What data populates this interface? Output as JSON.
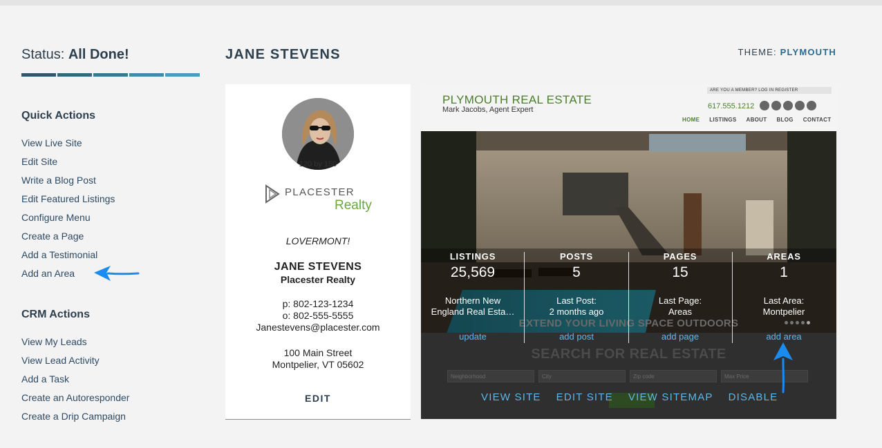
{
  "status": {
    "label": "Status:",
    "value": "All Done!",
    "bar_colors": [
      "#2e5871",
      "#33667f",
      "#3a7793",
      "#4389a8",
      "#4b9bbd"
    ]
  },
  "quick_actions": {
    "heading": "Quick Actions",
    "items": [
      "View Live Site",
      "Edit Site",
      "Write a Blog Post",
      "Edit Featured Listings",
      "Configure Menu",
      "Create a Page",
      "Add a Testimonial",
      "Add an Area"
    ]
  },
  "crm_actions": {
    "heading": "CRM Actions",
    "items": [
      "View My Leads",
      "View Lead Activity",
      "Add a Task",
      "Create an Autoresponder",
      "Create a Drip Campaign"
    ]
  },
  "header": {
    "site_name": "JANE STEVENS",
    "theme_label": "THEME:",
    "theme_name": "PLYMOUTH"
  },
  "profile": {
    "avatar_caption": "120 by 150",
    "logo_word1": "PLACESTER",
    "logo_word2": "Realty",
    "tagline": "LOVERMONT!",
    "name": "JANE STEVENS",
    "company": "Placester Realty",
    "phone": "p: 802-123-1234",
    "office": "o: 802-555-5555",
    "email": "Janestevens@placester.com",
    "address1": "100 Main Street",
    "address2": "Montpelier, VT 05602",
    "edit_label": "EDIT"
  },
  "preview": {
    "title": "PLYMOUTH REAL ESTATE",
    "subtitle": "Mark Jacobs, Agent Expert",
    "member_bar": "ARE YOU A MEMBER?   LOG IN   REGISTER",
    "phone": "617.555.1212",
    "nav": [
      "HOME",
      "LISTINGS",
      "ABOUT",
      "BLOG",
      "CONTACT"
    ],
    "extend_text": "EXTEND YOUR LIVING SPACE OUTDOORS",
    "search_text": "SEARCH FOR REAL ESTATE",
    "fields": [
      "Neighborhood",
      "City",
      "Zip code",
      "Max Price"
    ]
  },
  "stats": [
    {
      "label": "LISTINGS",
      "value": "25,569",
      "desc1": "Northern New",
      "desc2": "England Real Esta…",
      "action": "update"
    },
    {
      "label": "POSTS",
      "value": "5",
      "desc1": "Last Post:",
      "desc2": "2 months ago",
      "action": "add post"
    },
    {
      "label": "PAGES",
      "value": "15",
      "desc1": "Last Page:",
      "desc2": "Areas",
      "action": "add page"
    },
    {
      "label": "AREAS",
      "value": "1",
      "desc1": "Last Area:",
      "desc2": "Montpelier",
      "action": "add area"
    }
  ],
  "site_actions": [
    "VIEW SITE",
    "EDIT SITE",
    "VIEW SITEMAP",
    "DISABLE"
  ],
  "colors": {
    "link_blue": "#5fb7e8",
    "arrow_blue": "#1a8cf0",
    "brand_green": "#4c7d2d"
  }
}
